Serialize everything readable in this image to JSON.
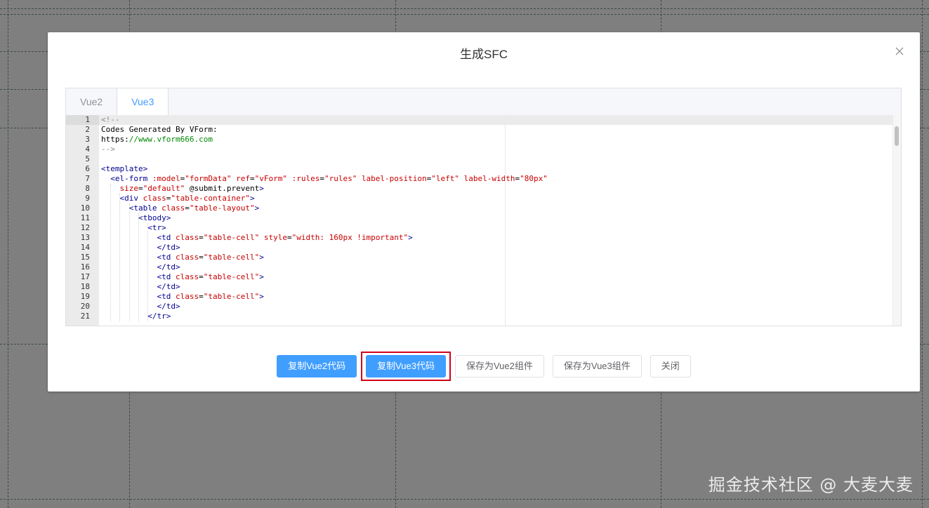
{
  "dialog": {
    "title": "生成SFC",
    "close_icon": "close-icon"
  },
  "tabs": [
    {
      "label": "Vue2",
      "active": false
    },
    {
      "label": "Vue3",
      "active": true
    }
  ],
  "editor": {
    "active_line": 1,
    "lines": [
      {
        "n": "1",
        "html": "<span class=\"t-c\">&lt;!--</span>"
      },
      {
        "n": "2",
        "html": "Codes Generated By VForm:"
      },
      {
        "n": "3",
        "html": "https:<span class=\"t-link\">//www.vform666.com</span>"
      },
      {
        "n": "4",
        "html": "<span class=\"t-c\">--&gt;</span>"
      },
      {
        "n": "5",
        "html": ""
      },
      {
        "n": "6",
        "html": "<span class=\"t-tag\">&lt;template&gt;</span>"
      },
      {
        "n": "7",
        "html": "  <span class=\"t-tag\">&lt;el-form</span> <span class=\"t-attr\">:model</span>=<span class=\"t-str\">\"formData\"</span> <span class=\"t-attr\">ref</span>=<span class=\"t-str\">\"vForm\"</span> <span class=\"t-attr\">:rules</span>=<span class=\"t-str\">\"rules\"</span> <span class=\"t-attr\">label-position</span>=<span class=\"t-str\">\"left\"</span> <span class=\"t-attr\">label-width</span>=<span class=\"t-str\">\"80px\"</span>"
      },
      {
        "n": "8",
        "html": "    <span class=\"t-attr\">size</span>=<span class=\"t-str\">\"default\"</span> @submit.prevent<span class=\"t-tag\">&gt;</span>"
      },
      {
        "n": "9",
        "html": "    <span class=\"t-tag\">&lt;div</span> <span class=\"t-attr\">class</span>=<span class=\"t-str\">\"table-container\"</span><span class=\"t-tag\">&gt;</span>"
      },
      {
        "n": "10",
        "html": "      <span class=\"t-tag\">&lt;table</span> <span class=\"t-attr\">class</span>=<span class=\"t-str\">\"table-layout\"</span><span class=\"t-tag\">&gt;</span>"
      },
      {
        "n": "11",
        "html": "        <span class=\"t-tag\">&lt;tbody&gt;</span>"
      },
      {
        "n": "12",
        "html": "          <span class=\"t-tag\">&lt;tr&gt;</span>"
      },
      {
        "n": "13",
        "html": "            <span class=\"t-tag\">&lt;td</span> <span class=\"t-attr\">class</span>=<span class=\"t-str\">\"table-cell\"</span> <span class=\"t-attr\">style</span>=<span class=\"t-str\">\"width: 160px !important\"</span><span class=\"t-tag\">&gt;</span>"
      },
      {
        "n": "14",
        "html": "            <span class=\"t-tag\">&lt;/td&gt;</span>"
      },
      {
        "n": "15",
        "html": "            <span class=\"t-tag\">&lt;td</span> <span class=\"t-attr\">class</span>=<span class=\"t-str\">\"table-cell\"</span><span class=\"t-tag\">&gt;</span>"
      },
      {
        "n": "16",
        "html": "            <span class=\"t-tag\">&lt;/td&gt;</span>"
      },
      {
        "n": "17",
        "html": "            <span class=\"t-tag\">&lt;td</span> <span class=\"t-attr\">class</span>=<span class=\"t-str\">\"table-cell\"</span><span class=\"t-tag\">&gt;</span>"
      },
      {
        "n": "18",
        "html": "            <span class=\"t-tag\">&lt;/td&gt;</span>"
      },
      {
        "n": "19",
        "html": "            <span class=\"t-tag\">&lt;td</span> <span class=\"t-attr\">class</span>=<span class=\"t-str\">\"table-cell\"</span><span class=\"t-tag\">&gt;</span>"
      },
      {
        "n": "20",
        "html": "            <span class=\"t-tag\">&lt;/td&gt;</span>"
      },
      {
        "n": "21",
        "html": "          <span class=\"t-tag\">&lt;/tr&gt;</span>"
      }
    ]
  },
  "footer": {
    "copy_vue2": "复制Vue2代码",
    "copy_vue3": "复制Vue3代码",
    "save_vue2": "保存为Vue2组件",
    "save_vue3": "保存为Vue3组件",
    "close": "关闭"
  },
  "watermark": "掘金技术社区 @ 大麦大麦",
  "colors": {
    "primary": "#409eff",
    "highlight": "#d0021b",
    "overlay": "#7f7f7f"
  }
}
